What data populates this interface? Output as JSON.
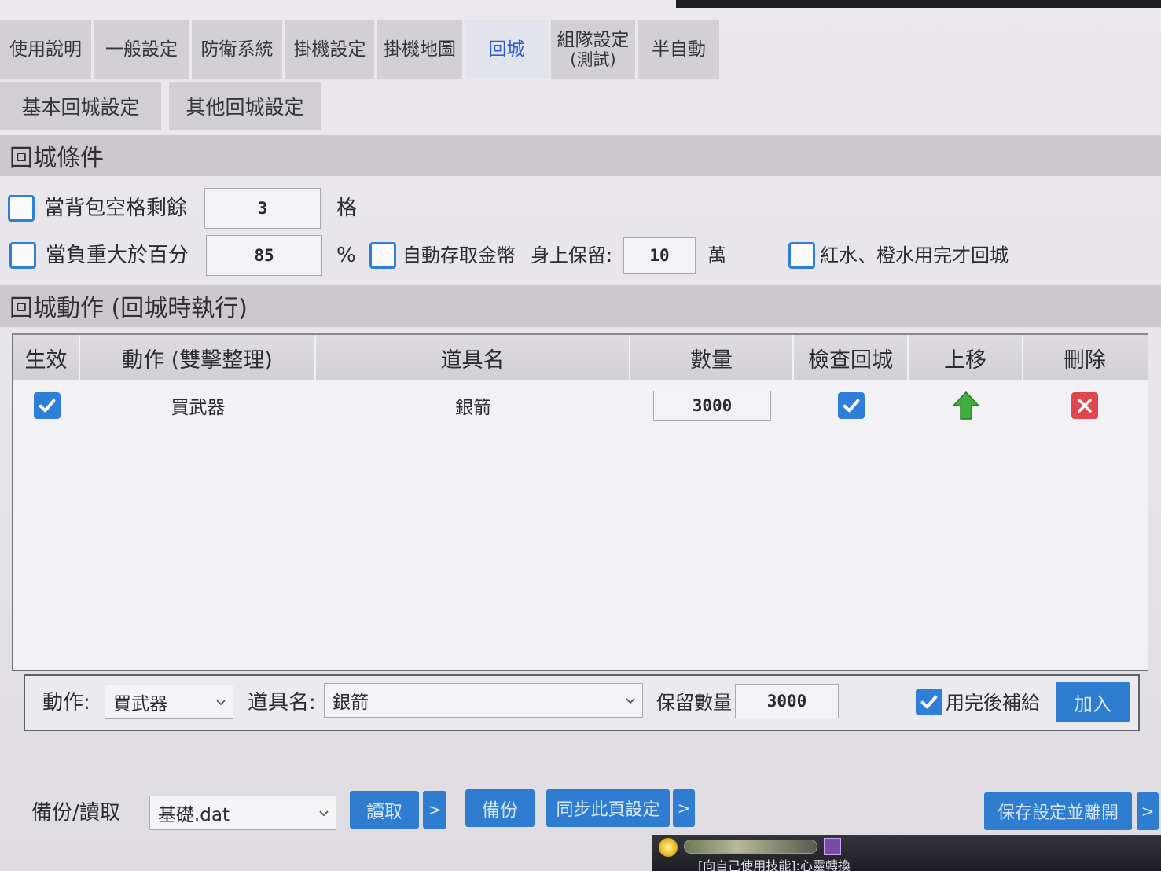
{
  "top_tabs": [
    {
      "label": "使用說明",
      "active": false
    },
    {
      "label": "一般設定",
      "active": false
    },
    {
      "label": "防衛系統",
      "active": false
    },
    {
      "label": "掛機設定",
      "active": false
    },
    {
      "label": "掛機地圖",
      "active": false
    },
    {
      "label": "回城",
      "active": true
    },
    {
      "label": "組隊設定",
      "sub": "(測試)",
      "active": false
    },
    {
      "label": "半自動",
      "active": false
    }
  ],
  "sub_tabs": [
    {
      "label": "基本回城設定"
    },
    {
      "label": "其他回城設定"
    }
  ],
  "conditions": {
    "title": "回城條件",
    "bag_space": {
      "checked": false,
      "label": "當背包空格剩餘",
      "value": "3",
      "unit": "格"
    },
    "weight": {
      "checked": false,
      "label": "當負重大於百分",
      "value": "85",
      "unit": "%"
    },
    "auto_gold": {
      "checked": false,
      "label": "自動存取金幣",
      "keep_label": "身上保留:",
      "value": "10",
      "unit": "萬"
    },
    "potions": {
      "checked": false,
      "label": "紅水、橙水用完才回城"
    }
  },
  "actions": {
    "title": "回城動作 (回城時執行)",
    "columns": [
      "生效",
      "動作 (雙擊整理)",
      "道具名",
      "數量",
      "檢查回城",
      "上移",
      "刪除"
    ],
    "rows": [
      {
        "enabled": true,
        "action": "買武器",
        "item": "銀箭",
        "qty": "3000",
        "check_return": true
      }
    ]
  },
  "add_form": {
    "action_label": "動作:",
    "action_value": "買武器",
    "item_label": "道具名:",
    "item_value": "銀箭",
    "keep_label": "保留數量",
    "keep_value": "3000",
    "refill_checked": true,
    "refill_label": "用完後補給",
    "add_button": "加入"
  },
  "footer": {
    "backup_label": "備份/讀取",
    "file_value": "基礎.dat",
    "load_button": "讀取",
    "load_more": ">",
    "backup_button": "備份",
    "sync_button": "同步此頁設定",
    "sync_more": ">",
    "save_button": "保存設定並離開",
    "save_more": ">"
  },
  "game_window": {
    "chat_line": "[向自己使用技能]:心靈轉換"
  },
  "icons": {
    "checkbox_mark": "check-icon",
    "dropdown": "chevron-down-icon",
    "move_up": "arrow-up-icon",
    "delete": "close-icon"
  },
  "colors": {
    "accent": "#2f7dd0",
    "active_tab_text": "#2c5fd4",
    "checkbox": "#2f7fd8",
    "move_up": "#3fae3c",
    "delete": "#e0474c",
    "section_band": "#ccc8cb"
  }
}
